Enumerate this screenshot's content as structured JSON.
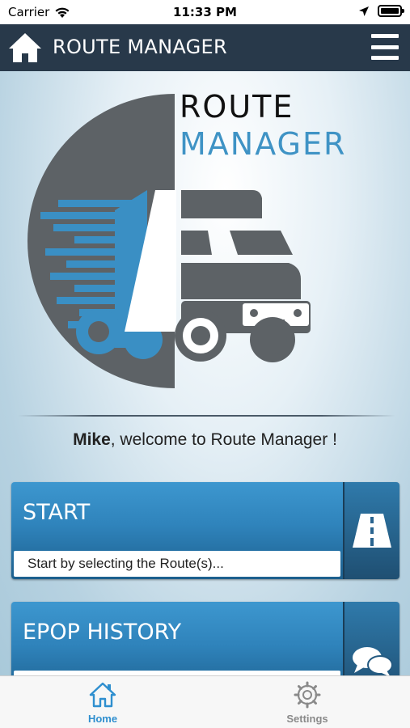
{
  "status_bar": {
    "carrier": "Carrier",
    "time": "11:33 PM"
  },
  "header": {
    "title": "ROUTE MANAGER"
  },
  "logo": {
    "word1": "ROUTE",
    "word2": "MANAGER"
  },
  "welcome": {
    "user": "Mike",
    "text": ", welcome to Route Manager !"
  },
  "cards": [
    {
      "title": "START",
      "subtitle": "Start by selecting the Route(s)...",
      "icon": "road-icon"
    },
    {
      "title": "EPOP HISTORY",
      "subtitle": "",
      "icon": "chat-bubbles-icon"
    }
  ],
  "tabs": [
    {
      "label": "Home",
      "icon": "home-icon",
      "active": true
    },
    {
      "label": "Settings",
      "icon": "gear-icon",
      "active": false
    }
  ],
  "colors": {
    "header_bg": "#28394a",
    "accent_blue": "#3f93c5",
    "tab_active": "#2f8fcf",
    "tab_inactive": "#8a8a8a"
  }
}
